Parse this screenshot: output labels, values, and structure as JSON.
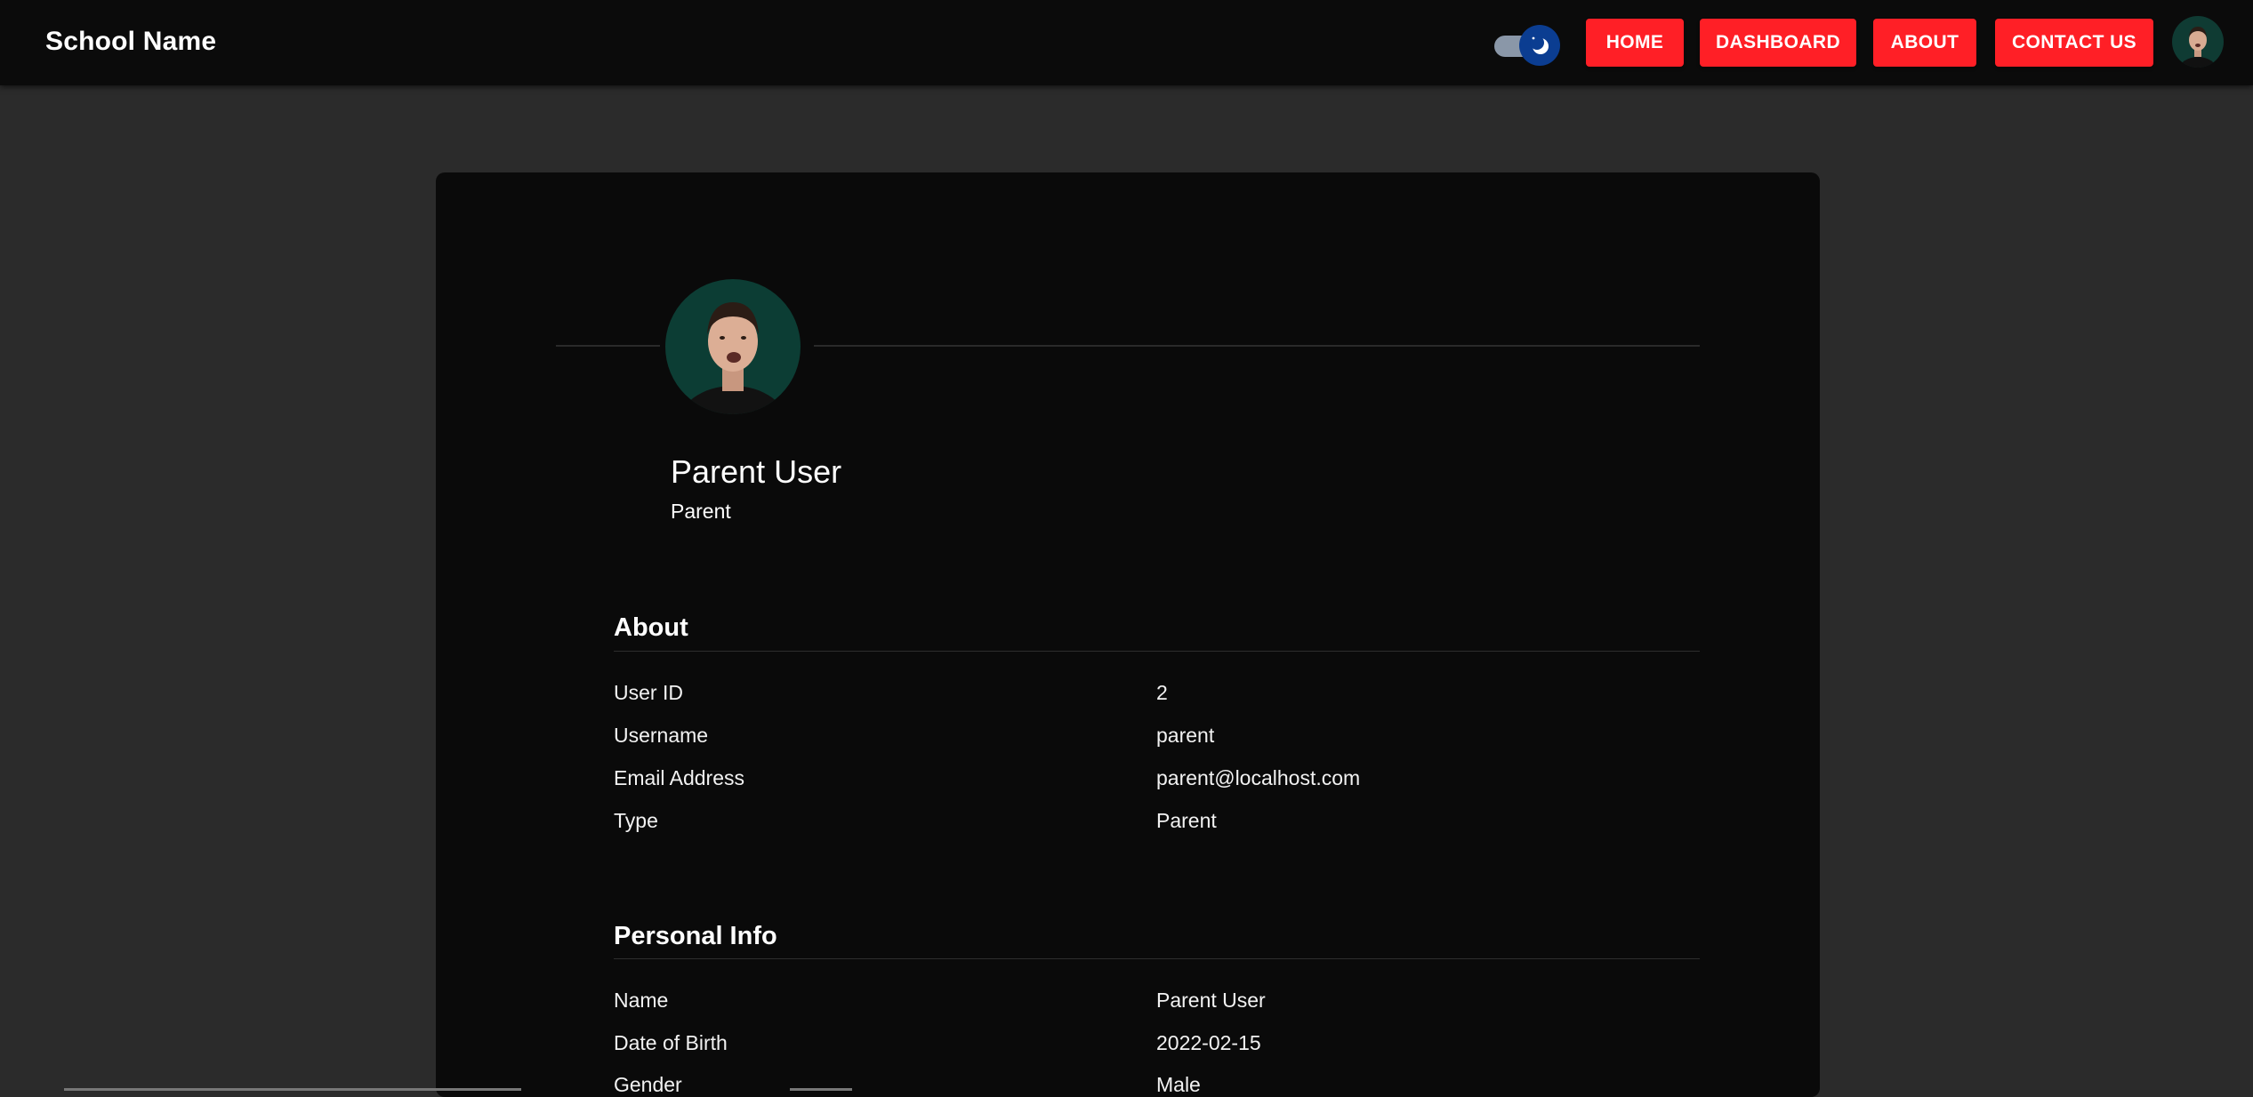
{
  "header": {
    "brand": "School Name",
    "nav": {
      "home": "HOME",
      "dashboard": "DASHBOARD",
      "about": "ABOUT",
      "contact": "CONTACT US"
    },
    "theme_toggle_icon": "moon-icon",
    "colors": {
      "nav_button": "#ff1f26",
      "toggle_knob": "#0b3d91"
    }
  },
  "profile": {
    "name": "Parent User",
    "role": "Parent"
  },
  "about": {
    "title": "About",
    "rows": [
      {
        "label": "User ID",
        "value": "2"
      },
      {
        "label": "Username",
        "value": "parent"
      },
      {
        "label": "Email Address",
        "value": "parent@localhost.com"
      },
      {
        "label": "Type",
        "value": "Parent"
      }
    ]
  },
  "personal": {
    "title": "Personal Info",
    "rows": [
      {
        "label": "Name",
        "value": "Parent User"
      },
      {
        "label": "Date of Birth",
        "value": "2022-02-15"
      },
      {
        "label": "Gender",
        "value": "Male"
      }
    ]
  }
}
